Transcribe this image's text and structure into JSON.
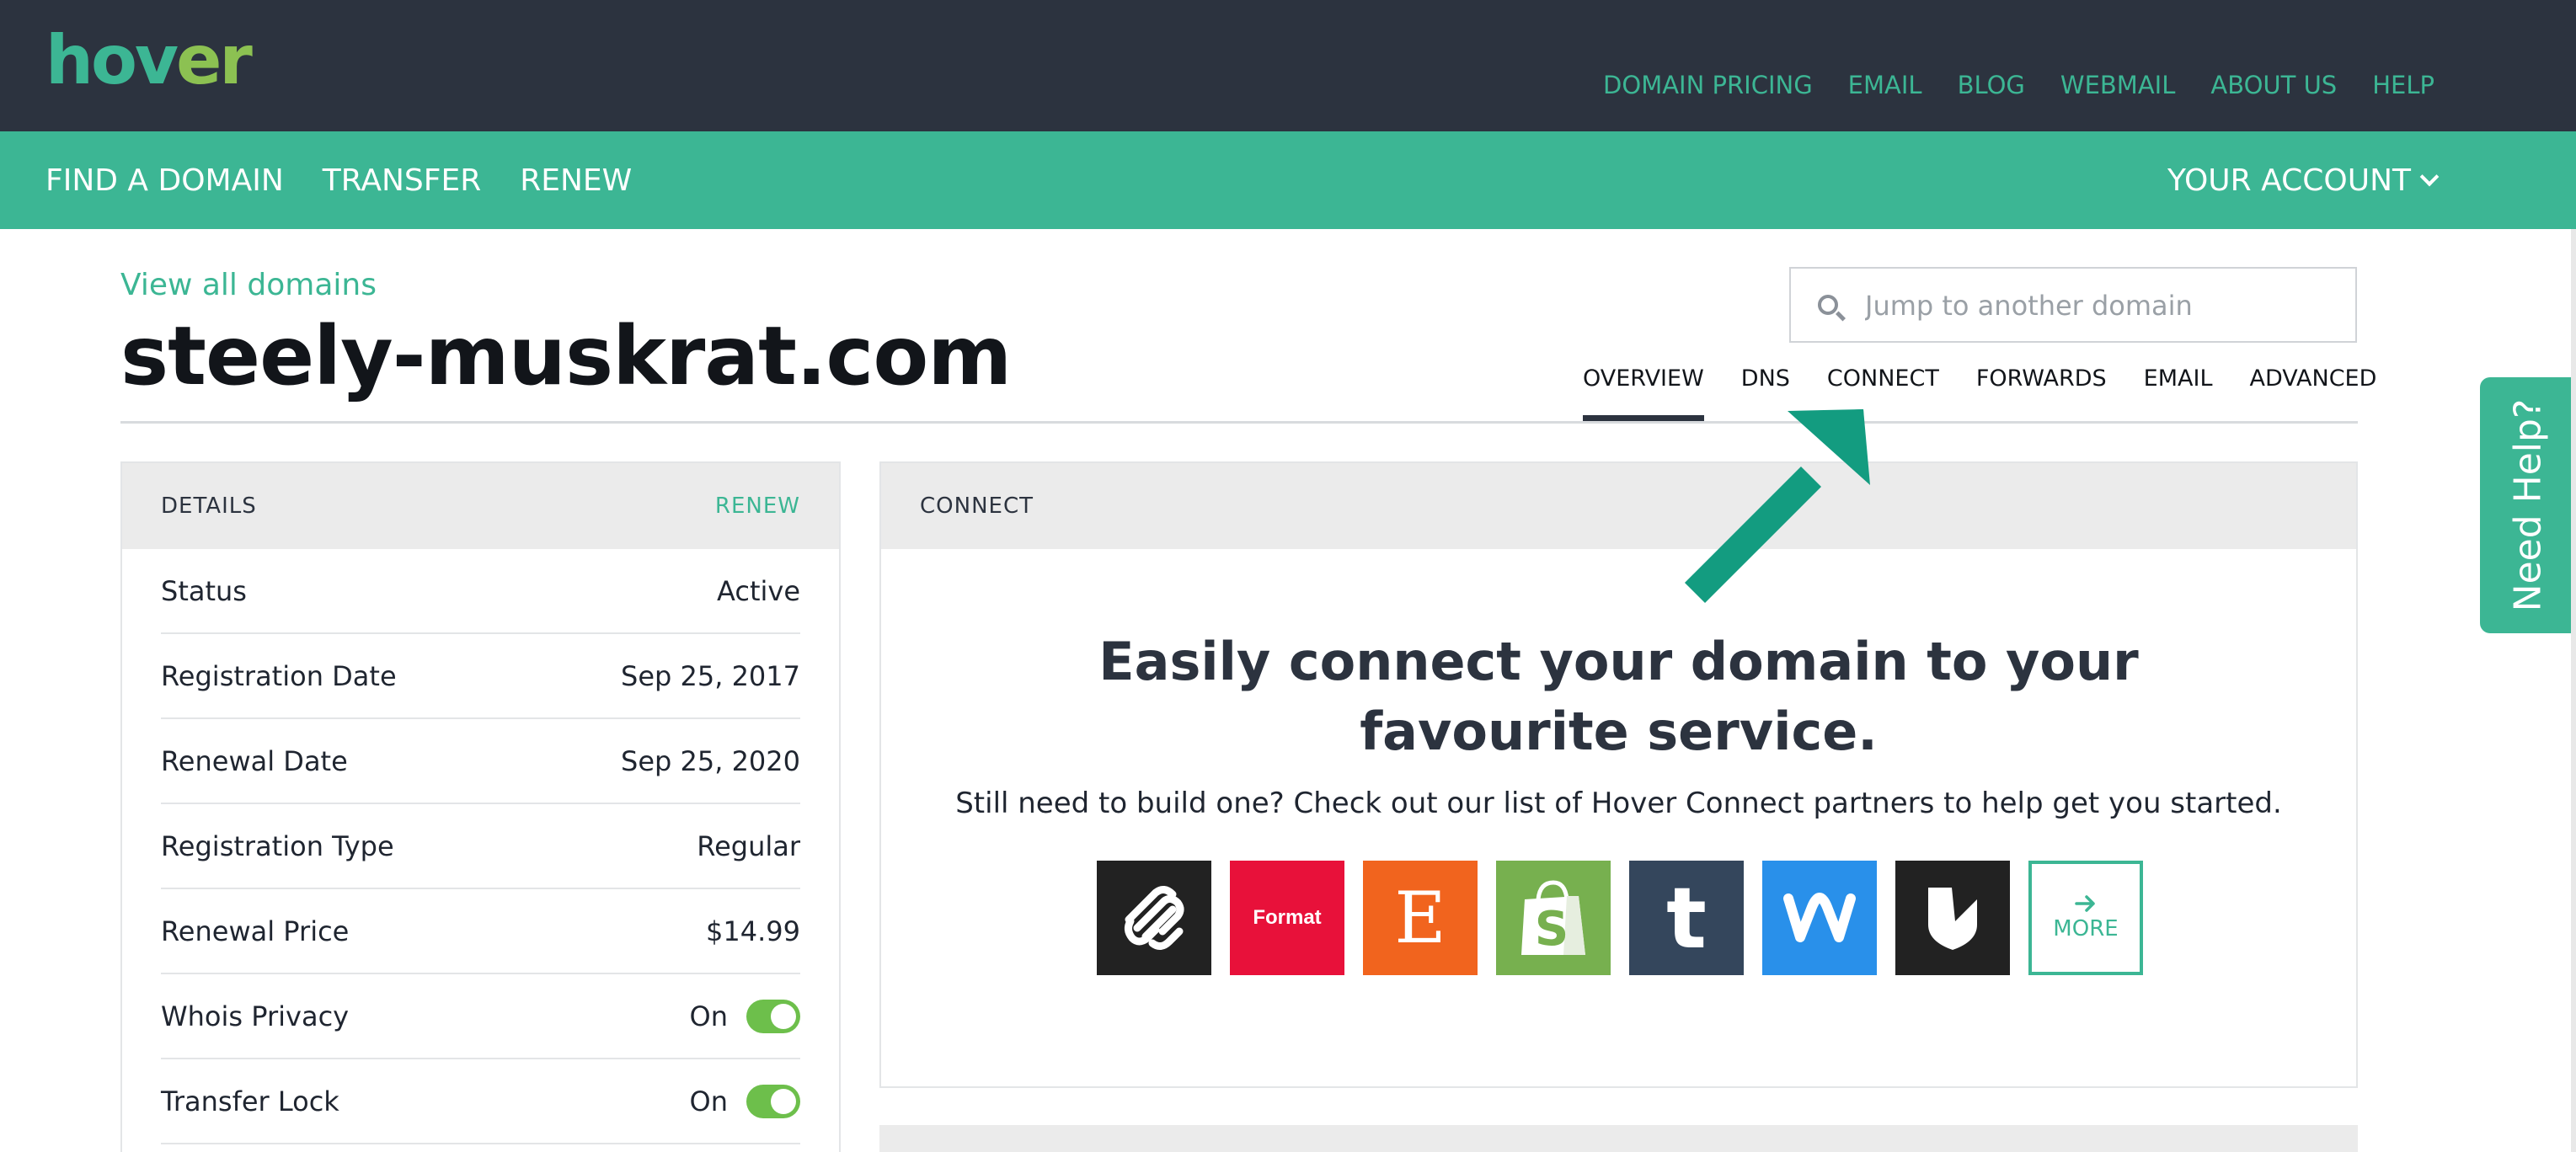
{
  "brand": {
    "logo_part1": "hov",
    "logo_part2": "er",
    "color_primary": "#3cb694",
    "color_lime": "#8cc152",
    "color_dark": "#2c333f"
  },
  "top_nav": [
    "DOMAIN PRICING",
    "EMAIL",
    "BLOG",
    "WEBMAIL",
    "ABOUT US",
    "HELP"
  ],
  "main_nav": [
    "FIND A DOMAIN",
    "TRANSFER",
    "RENEW"
  ],
  "account_label": "YOUR ACCOUNT",
  "view_all": "View all domains",
  "domain": "steely-muskrat.com",
  "search": {
    "placeholder": "Jump to another domain"
  },
  "tabs": [
    "OVERVIEW",
    "DNS",
    "CONNECT",
    "FORWARDS",
    "EMAIL",
    "ADVANCED"
  ],
  "active_tab": "OVERVIEW",
  "details": {
    "title": "DETAILS",
    "action": "RENEW",
    "rows": [
      {
        "label": "Status",
        "value": "Active"
      },
      {
        "label": "Registration Date",
        "value": "Sep 25, 2017"
      },
      {
        "label": "Renewal Date",
        "value": "Sep 25, 2020"
      },
      {
        "label": "Registration Type",
        "value": "Regular"
      },
      {
        "label": "Renewal Price",
        "value": "$14.99"
      },
      {
        "label": "Whois Privacy",
        "value": "On",
        "toggle": true
      },
      {
        "label": "Transfer Lock",
        "value": "On",
        "toggle": true
      }
    ]
  },
  "connect": {
    "title": "CONNECT",
    "heading": "Easily connect your domain to your favourite service.",
    "subtext": "Still need to build one? Check out our list of Hover Connect partners to help get you started.",
    "partners": [
      {
        "name": "squarespace",
        "icon": "squarespace-icon"
      },
      {
        "name": "format",
        "label": "Format"
      },
      {
        "name": "etsy",
        "label": "E"
      },
      {
        "name": "shopify",
        "icon": "shopify-bag-icon",
        "letter": "S"
      },
      {
        "name": "tumblr",
        "label": "t"
      },
      {
        "name": "weebly",
        "icon": "weebly-icon"
      },
      {
        "name": "bigcartel",
        "icon": "bigcartel-icon"
      }
    ],
    "more_label": "MORE"
  },
  "need_help": "Need Help?"
}
